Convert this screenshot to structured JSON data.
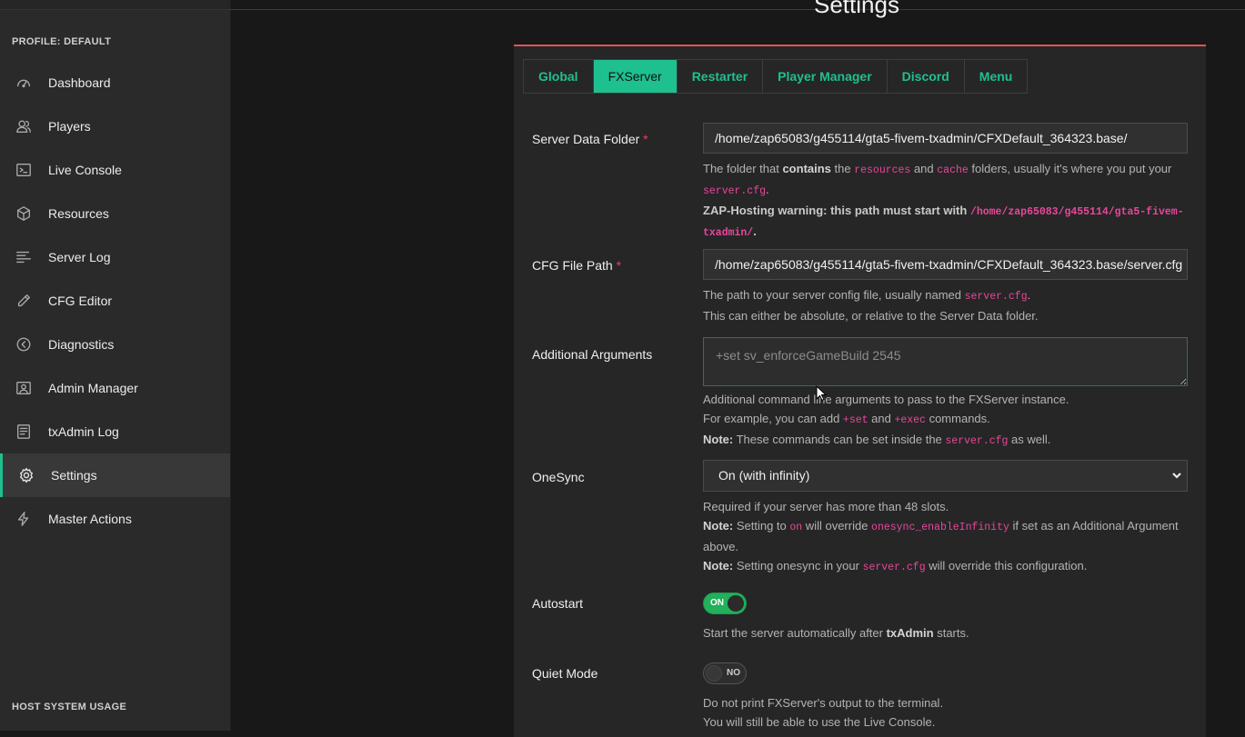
{
  "sidebar": {
    "profile_label": "PROFILE: DEFAULT",
    "items": [
      {
        "label": "Dashboard",
        "icon": "dashboard-icon"
      },
      {
        "label": "Players",
        "icon": "players-icon"
      },
      {
        "label": "Live Console",
        "icon": "terminal-icon"
      },
      {
        "label": "Resources",
        "icon": "cube-icon"
      },
      {
        "label": "Server Log",
        "icon": "list-icon"
      },
      {
        "label": "CFG Editor",
        "icon": "pencil-icon"
      },
      {
        "label": "Diagnostics",
        "icon": "chevron-circle-icon"
      },
      {
        "label": "Admin Manager",
        "icon": "admin-icon"
      },
      {
        "label": "txAdmin Log",
        "icon": "document-icon"
      },
      {
        "label": "Settings",
        "icon": "gear-icon",
        "active": true
      },
      {
        "label": "Master Actions",
        "icon": "bolt-icon"
      }
    ],
    "host_usage_label": "HOST SYSTEM USAGE"
  },
  "page": {
    "title": "Settings"
  },
  "tabs": [
    "Global",
    "FXServer",
    "Restarter",
    "Player Manager",
    "Discord",
    "Menu"
  ],
  "active_tab": "FXServer",
  "form": {
    "server_data_folder": {
      "label": "Server Data Folder",
      "required_mark": "*",
      "value": "/home/zap65083/g455114/gta5-fivem-txadmin/CFXDefault_364323.base/",
      "help": {
        "t1": "The folder that ",
        "b1": "contains",
        "t2": " the ",
        "c1": "resources",
        "t3": " and ",
        "c2": "cache",
        "t4": " folders, usually it's where you put your ",
        "c3": "server.cfg",
        "t5": ".",
        "warn_text": "ZAP-Hosting warning: this path must start with ",
        "warn_code": "/home/zap65083/g455114/gta5-fivem-txadmin/",
        "warn_end": "."
      }
    },
    "cfg_file_path": {
      "label": "CFG File Path",
      "required_mark": "*",
      "value": "/home/zap65083/g455114/gta5-fivem-txadmin/CFXDefault_364323.base/server.cfg",
      "help": {
        "t1": "The path to your server config file, usually named ",
        "c1": "server.cfg",
        "t2": ".",
        "line2": "This can either be absolute, or relative to the Server Data folder."
      }
    },
    "additional_arguments": {
      "label": "Additional Arguments",
      "placeholder": "+set sv_enforceGameBuild 2545",
      "help": {
        "line1": "Additional command line arguments to pass to the FXServer instance.",
        "t1": "For example, you can add ",
        "c1": "+set",
        "t2": " and ",
        "c2": "+exec",
        "t3": " commands.",
        "note": "Note:",
        "t4": " These commands can be set inside the ",
        "c3": "server.cfg",
        "t5": " as well."
      }
    },
    "onesync": {
      "label": "OneSync",
      "value": "On (with infinity)",
      "help": {
        "line1": "Required if your server has more than 48 slots.",
        "note1": "Note:",
        "t1": " Setting to ",
        "c1": "on",
        "t2": " will override ",
        "c2": "onesync_enableInfinity",
        "t3": " if set as an Additional Argument above.",
        "note2": "Note:",
        "t4": " Setting onesync in your ",
        "c3": "server.cfg",
        "t5": " will override this configuration."
      }
    },
    "autostart": {
      "label": "Autostart",
      "toggle_text": "ON",
      "help": {
        "t1": "Start the server automatically after ",
        "b1": "txAdmin",
        "t2": " starts."
      }
    },
    "quiet_mode": {
      "label": "Quiet Mode",
      "toggle_text": "NO",
      "help": {
        "line1": "Do not print FXServer's output to the terminal.",
        "line2": "You will still be able to use the Live Console."
      }
    }
  },
  "colors": {
    "accent": "#1ec08f",
    "card_border": "#e05555",
    "code": "#e8479b",
    "toggle_on": "#22b05a"
  }
}
